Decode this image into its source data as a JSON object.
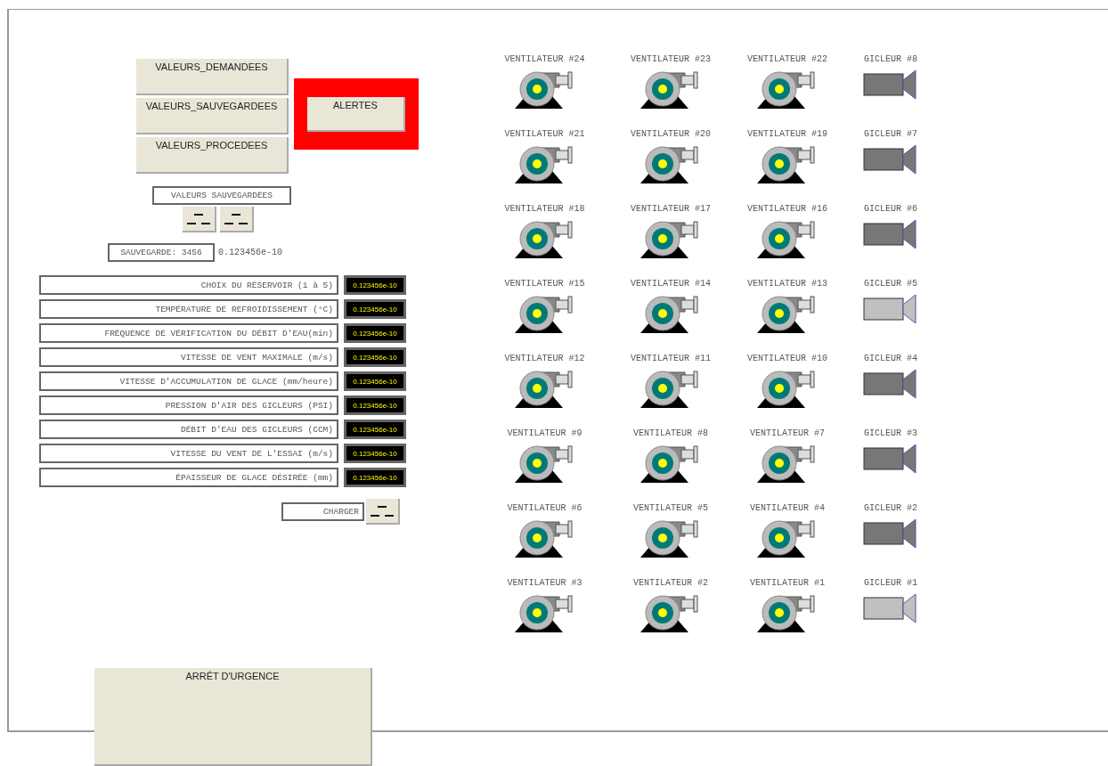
{
  "nav_buttons": [
    "VALEURS_DEMANDEES",
    "VALEURS_SAUVEGARDEES",
    "VALEURS_PROCEDEES"
  ],
  "alert_button": {
    "label": "ALERTES",
    "alarm": true
  },
  "saved_values": {
    "title": "VALEURS SAUVEGARDÉES",
    "save_label": "SAUVEGARDE: 3456",
    "save_value": "0.123456e-10"
  },
  "parameters": [
    {
      "label": "CHOIX DU RÉSERVOIR (1 à 5)",
      "value": "0.123456e-10"
    },
    {
      "label": "TEMPÉRATURE DE REFROIDISSEMENT (°C)",
      "value": "0.123456e-10"
    },
    {
      "label": "FRÉQUENCE DE VÉRIFICATION DU DÉBIT D'EAU(min)",
      "value": "0.123456e-10"
    },
    {
      "label": "VITESSE DE VENT MAXIMALE (m/s)",
      "value": "0.123456e-10"
    },
    {
      "label": "VITESSE D'ACCUMULATION DE GLACE (mm/heure)",
      "value": "0.123456e-10"
    },
    {
      "label": "PRESSION D'AIR DES GICLEURS (PSI)",
      "value": "0.123456e-10"
    },
    {
      "label": "DÉBIT D'EAU DES GICLEURS (CCM)",
      "value": "0.123456e-10"
    },
    {
      "label": "VITESSE DU VENT DE L'ESSAI (m/s)",
      "value": "0.123456e-10"
    },
    {
      "label": "ÉPAISSEUR DE GLACE DÉSIRÉE (mm)",
      "value": "0.123456e-10"
    }
  ],
  "load": {
    "label": "CHARGER"
  },
  "devices": [
    {
      "kind": "fan",
      "label": "VENTILATEUR #24"
    },
    {
      "kind": "fan",
      "label": "VENTILATEUR #23"
    },
    {
      "kind": "fan",
      "label": "VENTILATEUR #22"
    },
    {
      "kind": "sprinkler",
      "label": "GICLEUR #8",
      "on": true
    },
    {
      "kind": "fan",
      "label": "VENTILATEUR #21"
    },
    {
      "kind": "fan",
      "label": "VENTILATEUR #20"
    },
    {
      "kind": "fan",
      "label": "VENTILATEUR #19"
    },
    {
      "kind": "sprinkler",
      "label": "GICLEUR #7",
      "on": true
    },
    {
      "kind": "fan",
      "label": "VENTILATEUR #18"
    },
    {
      "kind": "fan",
      "label": "VENTILATEUR #17"
    },
    {
      "kind": "fan",
      "label": "VENTILATEUR #16"
    },
    {
      "kind": "sprinkler",
      "label": "GICLEUR #6",
      "on": true
    },
    {
      "kind": "fan",
      "label": "VENTILATEUR #15"
    },
    {
      "kind": "fan",
      "label": "VENTILATEUR #14"
    },
    {
      "kind": "fan",
      "label": "VENTILATEUR #13"
    },
    {
      "kind": "sprinkler",
      "label": "GICLEUR #5",
      "on": false
    },
    {
      "kind": "fan",
      "label": "VENTILATEUR #12"
    },
    {
      "kind": "fan",
      "label": "VENTILATEUR #11"
    },
    {
      "kind": "fan",
      "label": "VENTILATEUR #10"
    },
    {
      "kind": "sprinkler",
      "label": "GICLEUR #4",
      "on": true
    },
    {
      "kind": "fan",
      "label": "VENTILATEUR #9"
    },
    {
      "kind": "fan",
      "label": "VENTILATEUR #8"
    },
    {
      "kind": "fan",
      "label": "VENTILATEUR #7"
    },
    {
      "kind": "sprinkler",
      "label": "GICLEUR #3",
      "on": true
    },
    {
      "kind": "fan",
      "label": "VENTILATEUR #6"
    },
    {
      "kind": "fan",
      "label": "VENTILATEUR #5"
    },
    {
      "kind": "fan",
      "label": "VENTILATEUR #4"
    },
    {
      "kind": "sprinkler",
      "label": "GICLEUR #2",
      "on": true
    },
    {
      "kind": "fan",
      "label": "VENTILATEUR #3"
    },
    {
      "kind": "fan",
      "label": "VENTILATEUR #2"
    },
    {
      "kind": "fan",
      "label": "VENTILATEUR #1"
    },
    {
      "kind": "sprinkler",
      "label": "GICLEUR #1",
      "on": false
    }
  ],
  "emergency_button": {
    "label": "ARRÊT D'URGENCE"
  }
}
